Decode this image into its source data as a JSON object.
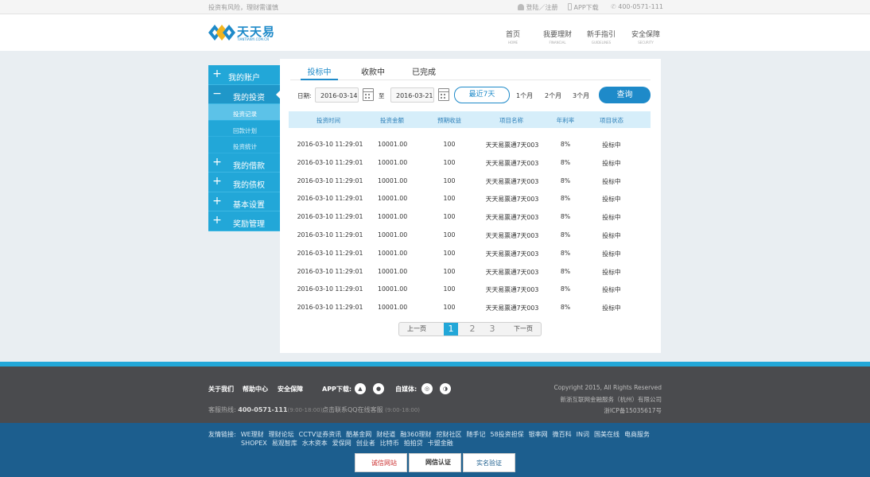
{
  "topbar": {
    "tip": "投资有风险，理财需谨慎",
    "login": "登陆／注册",
    "app": "APP下载",
    "phone": "400-0571-111"
  },
  "logo": {
    "cn": "天天易",
    "en": "TIANTIANYI.COM.CN"
  },
  "nav": [
    {
      "cn": "首页",
      "en": "HOME"
    },
    {
      "cn": "我要理财",
      "en": "FINANCIAL"
    },
    {
      "cn": "新手指引",
      "en": "GUIDELINES"
    },
    {
      "cn": "安全保障",
      "en": "SECURITY"
    }
  ],
  "sidebar": {
    "account": "我的账户",
    "invest": "我的投资",
    "sub": [
      "投资记录",
      "回款计划",
      "投资统计"
    ],
    "loan": "我的借款",
    "debt": "我的债权",
    "settings": "基本设置",
    "reward": "奖励管理"
  },
  "tabs": [
    "投标中",
    "收款中",
    "已完成"
  ],
  "filter": {
    "date_label": "日期:",
    "start": "2016-03-14",
    "to": "至",
    "end": "2016-03-21",
    "recent7": "最近7天",
    "m1": "1个月",
    "m2": "2个月",
    "m3": "3个月",
    "query": "查询"
  },
  "table": {
    "headers": [
      "投资时间",
      "投资金额",
      "预期收益",
      "项目名称",
      "年利率",
      "项目状态"
    ],
    "rows": [
      [
        "2016-03-10 11:29:01",
        "10001.00",
        "100",
        "天天易票通7天003",
        "8%",
        "投标中"
      ],
      [
        "2016-03-10 11:29:01",
        "10001.00",
        "100",
        "天天易票通7天003",
        "8%",
        "投标中"
      ],
      [
        "2016-03-10 11:29:01",
        "10001.00",
        "100",
        "天天易票通7天003",
        "8%",
        "投标中"
      ],
      [
        "2016-03-10 11:29:01",
        "10001.00",
        "100",
        "天天易票通7天003",
        "8%",
        "投标中"
      ],
      [
        "2016-03-10 11:29:01",
        "10001.00",
        "100",
        "天天易票通7天003",
        "8%",
        "投标中"
      ],
      [
        "2016-03-10 11:29:01",
        "10001.00",
        "100",
        "天天易票通7天003",
        "8%",
        "投标中"
      ],
      [
        "2016-03-10 11:29:01",
        "10001.00",
        "100",
        "天天易票通7天003",
        "8%",
        "投标中"
      ],
      [
        "2016-03-10 11:29:01",
        "10001.00",
        "100",
        "天天易票通7天003",
        "8%",
        "投标中"
      ],
      [
        "2016-03-10 11:29:01",
        "10001.00",
        "100",
        "天天易票通7天003",
        "8%",
        "投标中"
      ],
      [
        "2016-03-10 11:29:01",
        "10001.00",
        "100",
        "天天易票通7天003",
        "8%",
        "投标中"
      ]
    ]
  },
  "pager": {
    "prev": "上一页",
    "pages": [
      "1",
      "2",
      "3"
    ],
    "current": "1",
    "next": "下一页"
  },
  "footer": {
    "about": "关于我们",
    "help": "帮助中心",
    "security": "安全保障",
    "app_label": "APP下载:",
    "media_label": "自媒体:",
    "hotline_label": "客服热线:",
    "hotline": "400-0571-111",
    "hotline_hours": "(9:00-18:00)",
    "qq": "点击联系QQ在线客服",
    "qq_hours": "(9:00-18:00)",
    "copyright": "Copyright 2015, All Rights Reserved",
    "company": "新浙互联网金融服务（杭州）有限公司",
    "icp": "浙ICP备15035617号",
    "links_label": "友情链接:",
    "links": [
      "WE理财",
      "理财论坛",
      "CCTV证券资讯",
      "酷基金网",
      "财经道",
      "融360理财",
      "挖财社区",
      "随手记",
      "58投资担保",
      "银率网",
      "微百科",
      "IN词",
      "国美在线",
      "电商服务",
      "SHOPEX",
      "易观智库",
      "水木资本",
      "爱保网",
      "创业者",
      "比特币",
      "拍拍贷",
      "卡盟金融"
    ],
    "badges": [
      "诚信网站",
      "网信认证",
      "实名验证"
    ]
  }
}
